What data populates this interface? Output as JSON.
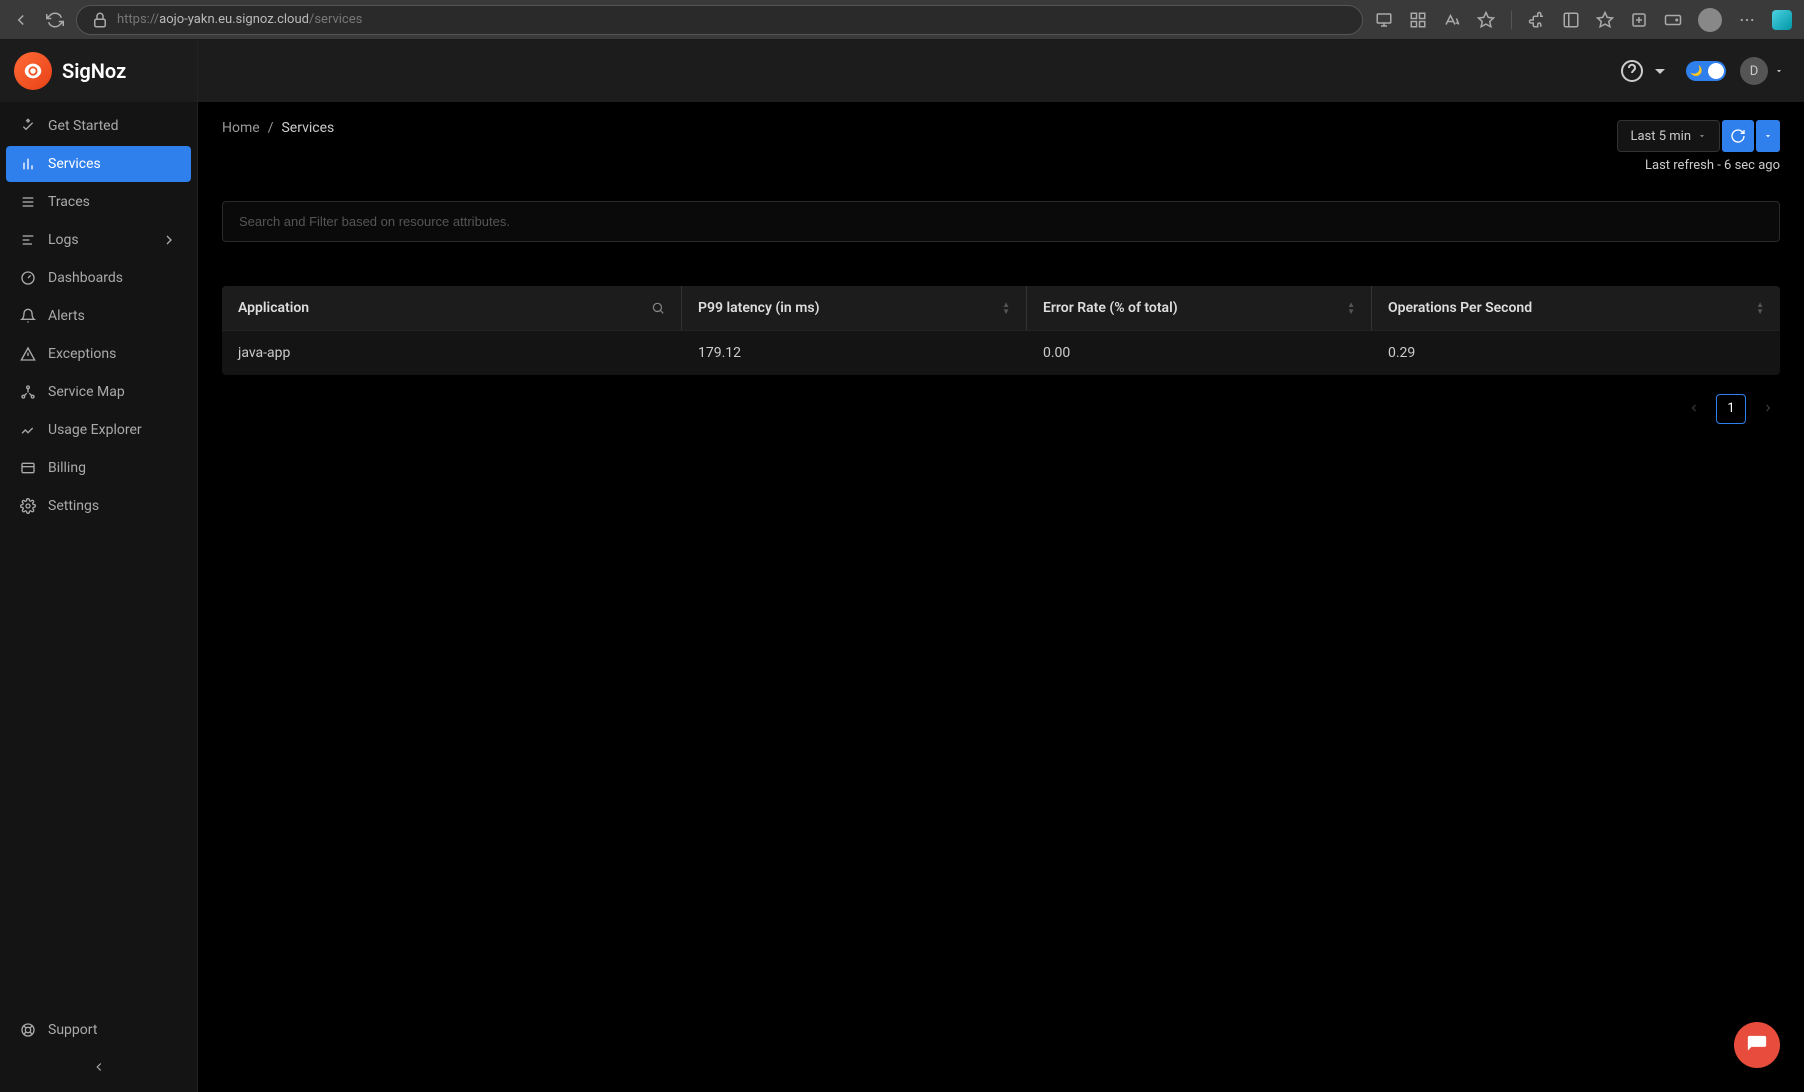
{
  "browser": {
    "url_prefix": "https://",
    "url_host": "aojo-yakn.eu.signoz.cloud",
    "url_path": "/services"
  },
  "brand": "SigNoz",
  "sidebar": {
    "items": [
      {
        "label": "Get Started",
        "icon": "rocket"
      },
      {
        "label": "Services",
        "icon": "bar-chart",
        "active": true
      },
      {
        "label": "Traces",
        "icon": "menu"
      },
      {
        "label": "Logs",
        "icon": "align-left",
        "chevron": true
      },
      {
        "label": "Dashboards",
        "icon": "dashboard"
      },
      {
        "label": "Alerts",
        "icon": "bell"
      },
      {
        "label": "Exceptions",
        "icon": "alert-triangle"
      },
      {
        "label": "Service Map",
        "icon": "deployment"
      },
      {
        "label": "Usage Explorer",
        "icon": "line-chart"
      },
      {
        "label": "Billing",
        "icon": "credit-card"
      },
      {
        "label": "Settings",
        "icon": "gear"
      }
    ],
    "support_label": "Support"
  },
  "header": {
    "user_initial": "D"
  },
  "breadcrumb": {
    "home": "Home",
    "sep": "/",
    "current": "Services"
  },
  "time": {
    "range_label": "Last 5 min",
    "last_refresh": "Last refresh - 6 sec ago"
  },
  "filter": {
    "placeholder": "Search and Filter based on resource attributes."
  },
  "table": {
    "columns": {
      "app": "Application",
      "p99": "P99 latency (in ms)",
      "err": "Error Rate (% of total)",
      "ops": "Operations Per Second"
    },
    "rows": [
      {
        "app": "java-app",
        "p99": "179.12",
        "err": "0.00",
        "ops": "0.29"
      }
    ]
  },
  "pagination": {
    "current": "1"
  }
}
